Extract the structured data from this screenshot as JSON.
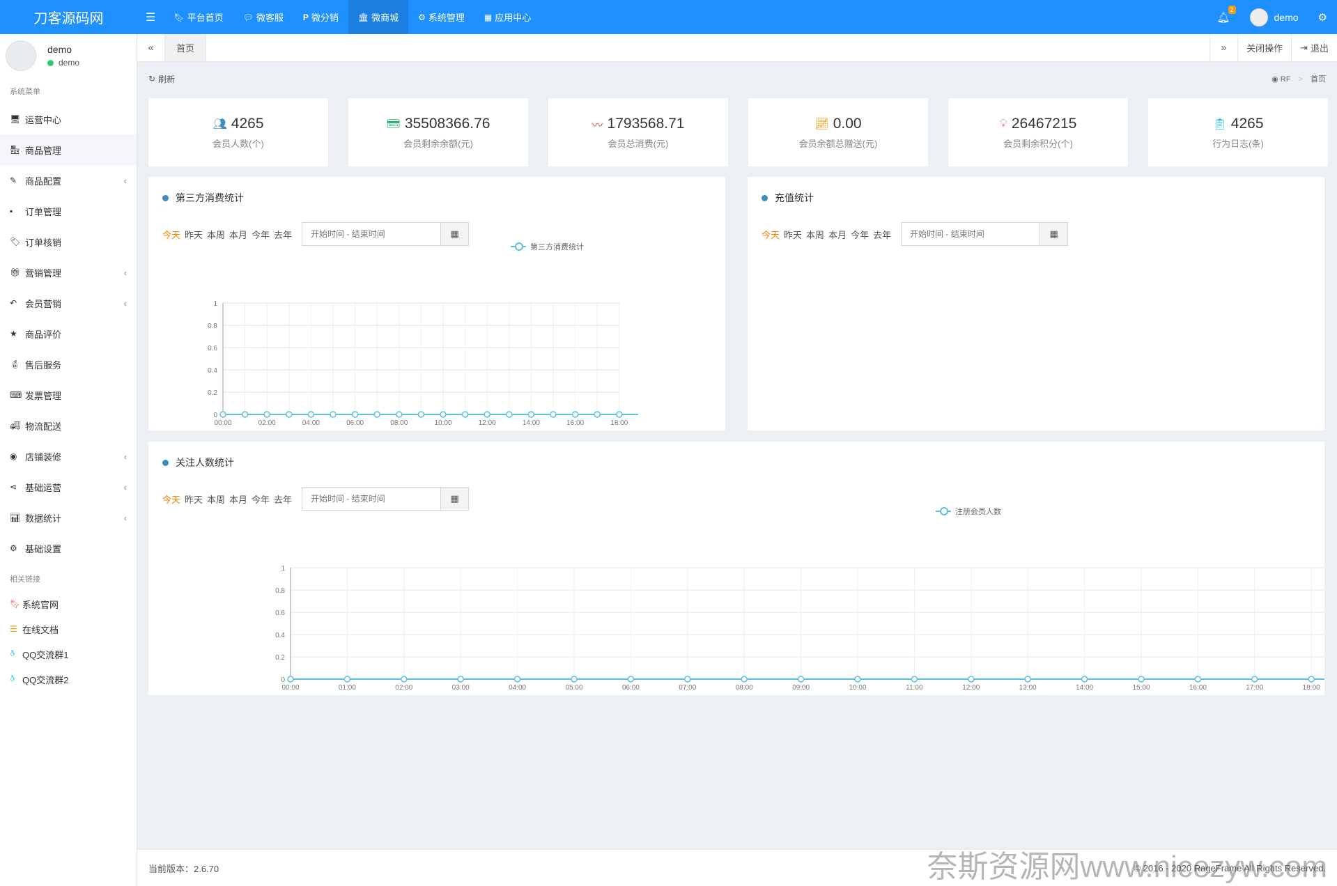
{
  "header": {
    "logo": "刀客源码网",
    "nav": [
      {
        "label": "平台首页",
        "icon": "bookmark-icon",
        "active": false
      },
      {
        "label": "微客服",
        "icon": "comments-icon",
        "active": false
      },
      {
        "label": "微分销",
        "icon": "paypal-icon",
        "active": false
      },
      {
        "label": "微商城",
        "icon": "bank-icon",
        "active": true
      },
      {
        "label": "系统管理",
        "icon": "cogs-icon",
        "active": false
      },
      {
        "label": "应用中心",
        "icon": "grid-icon",
        "active": false
      }
    ],
    "notify_count": "2",
    "user": "demo"
  },
  "sidebar": {
    "user_name": "demo",
    "user_status": "demo",
    "section_system": "系统菜单",
    "items": [
      {
        "label": "运营中心",
        "icon": "desktop-icon",
        "chev": false
      },
      {
        "label": "商品管理",
        "icon": "shop-icon",
        "chev": false
      },
      {
        "label": "商品配置",
        "icon": "pencil-icon",
        "chev": true
      },
      {
        "label": "订单管理",
        "icon": "order-icon",
        "chev": false
      },
      {
        "label": "订单核销",
        "icon": "tag-icon",
        "chev": false
      },
      {
        "label": "营销管理",
        "icon": "gift-icon",
        "chev": true
      },
      {
        "label": "会员营销",
        "icon": "reply-icon",
        "chev": true
      },
      {
        "label": "商品评价",
        "icon": "star-icon",
        "chev": false
      },
      {
        "label": "售后服务",
        "icon": "fire-extinguisher-icon",
        "chev": false
      },
      {
        "label": "发票管理",
        "icon": "keyboard-icon",
        "chev": false
      },
      {
        "label": "物流配送",
        "icon": "truck-icon",
        "chev": false
      },
      {
        "label": "店铺装修",
        "icon": "dashboard-icon",
        "chev": true
      },
      {
        "label": "基础运营",
        "icon": "share-icon",
        "chev": true
      },
      {
        "label": "数据统计",
        "icon": "bar-chart-icon",
        "chev": true
      },
      {
        "label": "基础设置",
        "icon": "cog-icon",
        "chev": false
      }
    ],
    "section_links": "相关链接",
    "links": [
      {
        "label": "系统官网",
        "icon": "bookmark-icon",
        "color": "#dd4b39"
      },
      {
        "label": "在线文档",
        "icon": "list-icon",
        "color": "#f39c12"
      },
      {
        "label": "QQ交流群1",
        "icon": "qq-icon",
        "color": "#00c0ef"
      },
      {
        "label": "QQ交流群2",
        "icon": "qq-icon",
        "color": "#00c0ef"
      }
    ]
  },
  "tabs": {
    "back": "«",
    "home": "首页",
    "forward": "»",
    "close_ops": "关闭操作",
    "logout": "退出"
  },
  "content": {
    "refresh": "刷新",
    "breadcrumb": {
      "root": "RF",
      "current": "首页"
    }
  },
  "stats": [
    {
      "value": "4265",
      "label": "会员人数(个)",
      "icon": "users-icon",
      "color": "#3c8dbc"
    },
    {
      "value": "35508366.76",
      "label": "会员剩余余额(元)",
      "icon": "credit-card-icon",
      "color": "#00a65a"
    },
    {
      "value": "1793568.71",
      "label": "会员总消费(元)",
      "icon": "heartbeat-icon",
      "color": "#dd4b39"
    },
    {
      "value": "0.00",
      "label": "会员余额总赠送(元)",
      "icon": "line-chart-icon",
      "color": "#f39c12"
    },
    {
      "value": "26467215",
      "label": "会员剩余积分(个)",
      "icon": "lightbulb-icon",
      "color": "#e83e8c"
    },
    {
      "value": "4265",
      "label": "行为日志(条)",
      "icon": "list-alt-icon",
      "color": "#00c0ef"
    }
  ],
  "filters": {
    "options": [
      "今天",
      "昨天",
      "本周",
      "本月",
      "今年",
      "去年"
    ],
    "selected": "今天",
    "placeholder": "开始时间 - 结束时间"
  },
  "panels": {
    "consume_title": "第三方消费统计",
    "recharge_title": "充值统计",
    "follow_title": "关注人数统计"
  },
  "chart_data": [
    {
      "type": "line",
      "title": "第三方消费统计",
      "x": [
        "00:00",
        "01:00",
        "02:00",
        "03:00",
        "04:00",
        "05:00",
        "06:00",
        "07:00",
        "08:00",
        "09:00",
        "10:00",
        "11:00",
        "12:00",
        "13:00",
        "14:00",
        "15:00",
        "16:00",
        "17:00",
        "18:00"
      ],
      "x_tick_labels": [
        "00:00",
        "02:00",
        "04:00",
        "06:00",
        "08:00",
        "10:00",
        "12:00",
        "14:00",
        "16:00",
        "18:00"
      ],
      "series": [
        {
          "name": "第三方消费统计",
          "values": [
            0,
            0,
            0,
            0,
            0,
            0,
            0,
            0,
            0,
            0,
            0,
            0,
            0,
            0,
            0,
            0,
            0,
            0,
            0
          ]
        }
      ],
      "y_ticks": [
        "0",
        "0.2",
        "0.4",
        "0.6",
        "0.8",
        "1"
      ],
      "ylim": [
        0,
        1
      ],
      "grid": true,
      "legend": "top-center",
      "color": "#5bc0de"
    },
    {
      "type": "line",
      "title": "关注人数统计",
      "x": [
        "00:00",
        "01:00",
        "02:00",
        "03:00",
        "04:00",
        "05:00",
        "06:00",
        "07:00",
        "08:00",
        "09:00",
        "10:00",
        "11:00",
        "12:00",
        "13:00",
        "14:00",
        "15:00",
        "16:00",
        "17:00",
        "18:00"
      ],
      "x_tick_labels": [
        "00:00",
        "01:00",
        "02:00",
        "03:00",
        "04:00",
        "05:00",
        "06:00",
        "07:00",
        "08:00",
        "09:00",
        "10:00",
        "11:00",
        "12:00",
        "13:00",
        "14:00",
        "15:00",
        "16:00",
        "17:00",
        "18:00"
      ],
      "series": [
        {
          "name": "注册会员人数",
          "values": [
            0,
            0,
            0,
            0,
            0,
            0,
            0,
            0,
            0,
            0,
            0,
            0,
            0,
            0,
            0,
            0,
            0,
            0,
            0
          ]
        }
      ],
      "y_ticks": [
        "0",
        "0.2",
        "0.4",
        "0.6",
        "0.8",
        "1"
      ],
      "ylim": [
        0,
        1
      ],
      "grid": true,
      "legend": "top-center",
      "color": "#5bc0de"
    }
  ],
  "footer": {
    "version": "当前版本：2.6.70",
    "copyright": "© 2016 - 2020 RageFrame All Rights Reserved."
  },
  "watermark": "奈斯资源网www.nicezyw.com"
}
